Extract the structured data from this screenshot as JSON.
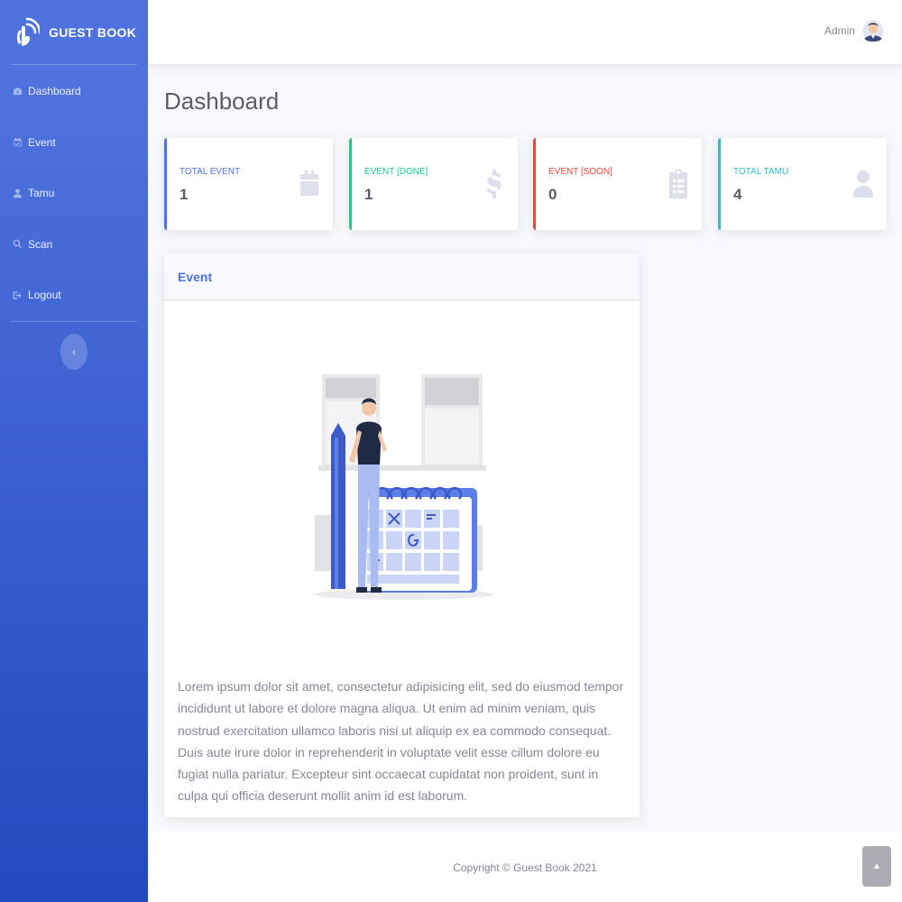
{
  "brand": {
    "name": "GUEST BOOK",
    "logo_icon": "wifi-hand-logo-icon"
  },
  "sidebar": {
    "items": [
      {
        "label": "Dashboard",
        "icon": "tachometer-icon"
      },
      {
        "label": "Event",
        "icon": "calendar-check-icon"
      },
      {
        "label": "Tamu",
        "icon": "user-icon"
      },
      {
        "label": "Scan",
        "icon": "search-icon"
      },
      {
        "label": "Logout",
        "icon": "sign-out-icon"
      }
    ],
    "toggle_label": "‹"
  },
  "topbar": {
    "user_name": "Admin"
  },
  "page": {
    "title": "Dashboard"
  },
  "stats": [
    {
      "label": "TOTAL EVENT",
      "value": "1",
      "color": "#4e73df",
      "icon": "calendar-icon"
    },
    {
      "label": "EVENT [DONE]",
      "value": "1",
      "color": "#1cc88a",
      "icon": "dollar-icon"
    },
    {
      "label": "EVENT [SOON]",
      "value": "0",
      "color": "#e74a3b",
      "icon": "clipboard-list-icon"
    },
    {
      "label": "TOTAL TAMU",
      "value": "4",
      "color": "#36b9cc",
      "icon": "user-icon"
    }
  ],
  "event_card": {
    "title": "Event",
    "text": "Lorem ipsum dolor sit amet, consectetur adipisicing elit, sed do eiusmod tempor incididunt ut labore et dolore magna aliqua. Ut enim ad minim veniam, quis nostrud exercitation ullamco laboris nisi ut aliquip ex ea commodo consequat. Duis aute irure dolor in reprehenderit in voluptate velit esse cillum dolore eu fugiat nulla pariatur. Excepteur sint occaecat cupidatat non proident, sunt in culpa qui officia deserunt mollit anim id est laborum."
  },
  "footer": {
    "copyright": "Copyright © Guest Book 2021"
  },
  "scroll_top": {
    "label": "▲"
  }
}
